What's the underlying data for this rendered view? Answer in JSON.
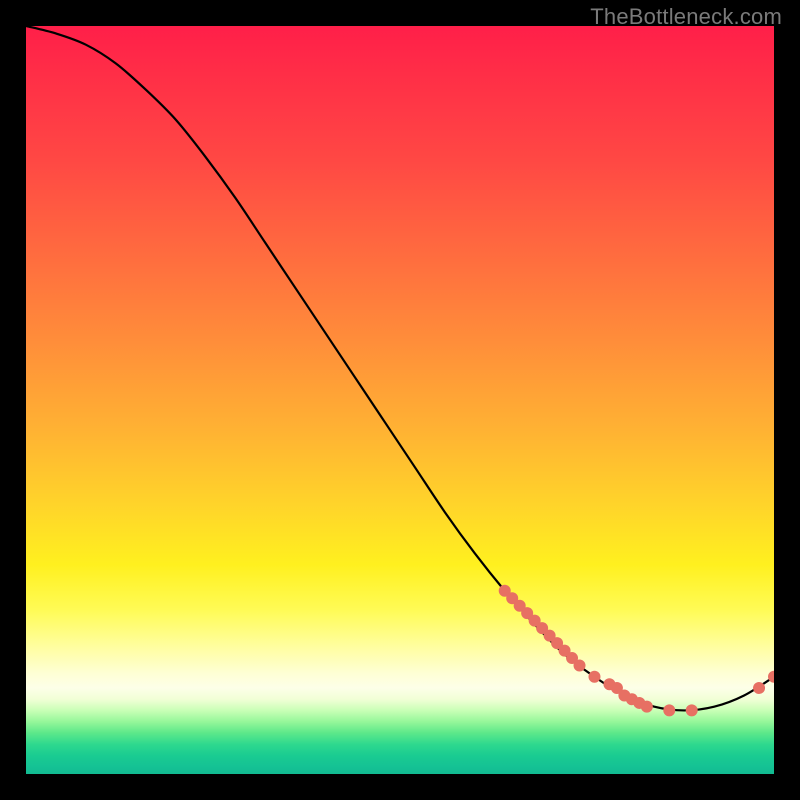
{
  "watermark": "TheBottleneck.com",
  "colors": {
    "background": "#000000",
    "curve_stroke": "#000000",
    "point_fill": "#e77063",
    "watermark_text": "#7a7a7a"
  },
  "chart_data": {
    "type": "line",
    "title": "",
    "xlabel": "",
    "ylabel": "",
    "xlim": [
      0,
      100
    ],
    "ylim": [
      0,
      100
    ],
    "grid": false,
    "legend": null,
    "series": [
      {
        "name": "bottleneck-curve",
        "x": [
          0,
          4,
          8,
          12,
          16,
          20,
          24,
          28,
          32,
          36,
          40,
          44,
          48,
          52,
          56,
          60,
          64,
          68,
          72,
          76,
          80,
          84,
          88,
          92,
          96,
          100
        ],
        "y": [
          100,
          99,
          97.5,
          95,
          91.5,
          87.5,
          82.5,
          77,
          71,
          65,
          59,
          53,
          47,
          41,
          35,
          29.5,
          24.5,
          20,
          16,
          13,
          10.5,
          9,
          8.5,
          9,
          10.5,
          13
        ]
      }
    ],
    "points": {
      "name": "highlighted-markers",
      "x": [
        64,
        65,
        66,
        67,
        68,
        69,
        70,
        71,
        72,
        73,
        74,
        76,
        78,
        79,
        80,
        81,
        82,
        83,
        86,
        89,
        98,
        100
      ],
      "y": [
        24.5,
        23.5,
        22.5,
        21.5,
        20.5,
        19.5,
        18.5,
        17.5,
        16.5,
        15.5,
        14.5,
        13,
        12,
        11.5,
        10.5,
        10,
        9.5,
        9,
        8.5,
        8.5,
        11.5,
        13
      ]
    }
  }
}
